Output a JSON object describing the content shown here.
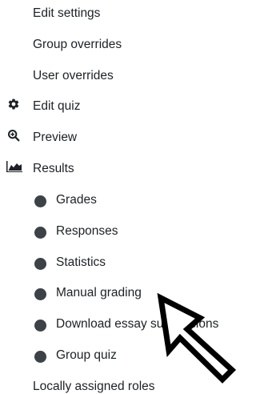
{
  "menu": {
    "items": [
      {
        "label": "Edit settings"
      },
      {
        "label": "Group overrides"
      },
      {
        "label": "User overrides"
      },
      {
        "label": "Edit quiz",
        "icon": "gear-icon"
      },
      {
        "label": "Preview",
        "icon": "magnifier-icon"
      },
      {
        "label": "Results",
        "icon": "area-chart-icon"
      }
    ],
    "results_subitems": [
      {
        "label": "Grades"
      },
      {
        "label": "Responses"
      },
      {
        "label": "Statistics"
      },
      {
        "label": "Manual grading"
      },
      {
        "label": "Download essay submissions"
      },
      {
        "label": "Group quiz"
      }
    ],
    "footer_item": {
      "label": "Locally assigned roles"
    }
  },
  "cursor": {
    "icon": "arrow-cursor-icon"
  }
}
